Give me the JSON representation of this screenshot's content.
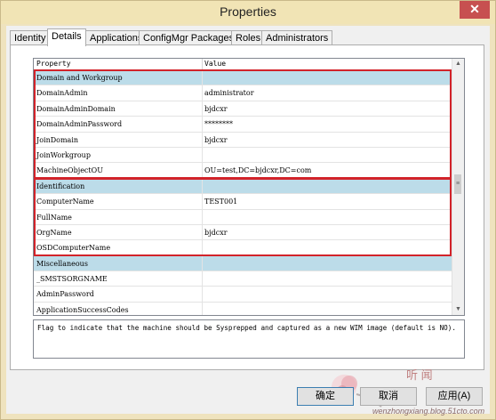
{
  "window": {
    "title": "Properties",
    "close_label": "✕"
  },
  "tabs": [
    {
      "label": "Identity"
    },
    {
      "label": "Details"
    },
    {
      "label": "Applications"
    },
    {
      "label": "ConfigMgr Packages"
    },
    {
      "label": "Roles"
    },
    {
      "label": "Administrators"
    }
  ],
  "active_tab": "Details",
  "grid": {
    "columns": {
      "property": "Property",
      "value": "Value"
    },
    "rows": [
      {
        "name": "Domain and Workgroup",
        "value": "",
        "category": true
      },
      {
        "name": "DomainAdmin",
        "value": "administrator"
      },
      {
        "name": "DomainAdminDomain",
        "value": "bjdcxr"
      },
      {
        "name": "DomainAdminPassword",
        "value": "********"
      },
      {
        "name": "JoinDomain",
        "value": "bjdcxr"
      },
      {
        "name": "JoinWorkgroup",
        "value": ""
      },
      {
        "name": "MachineObjectOU",
        "value": "OU=test,DC=bjdcxr,DC=com"
      },
      {
        "name": "Identification",
        "value": "",
        "category": true
      },
      {
        "name": "ComputerName",
        "value": "TEST001"
      },
      {
        "name": "FullName",
        "value": ""
      },
      {
        "name": "OrgName",
        "value": "bjdcxr"
      },
      {
        "name": "OSDComputerName",
        "value": ""
      },
      {
        "name": "Miscellaneous",
        "value": "",
        "category": true
      },
      {
        "name": "_SMSTSORGNAME",
        "value": ""
      },
      {
        "name": "AdminPassword",
        "value": ""
      },
      {
        "name": "ApplicationSuccessCodes",
        "value": ""
      }
    ],
    "scroll": {
      "up": "▲",
      "down": "▼",
      "thumb": "≡"
    }
  },
  "description": "Flag to indicate that the machine should be Sysprepped and captured as a new WIM image (default is NO).",
  "buttons": {
    "ok": "确定",
    "cancel": "取消",
    "apply": "应用(A)"
  },
  "watermark": {
    "cn": "听 闻",
    "url": "wenzhongxiang.blog.51cto.com"
  },
  "colors": {
    "highlight": "#d2232a",
    "category_bg": "#bcdce9",
    "title_bg": "#f1e4b5"
  }
}
